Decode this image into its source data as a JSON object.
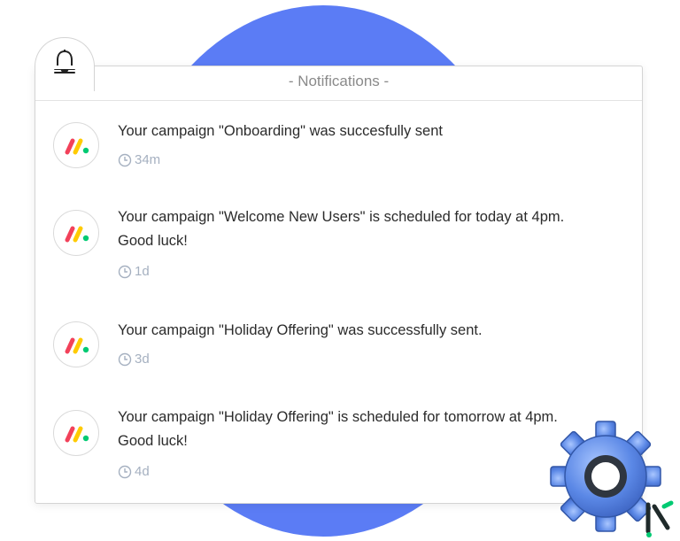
{
  "header": {
    "title": "- Notifications -"
  },
  "icons": {
    "bell": "bell-icon",
    "clock": "clock-icon",
    "gear": "gear-icon",
    "brand": "monday-logo-icon"
  },
  "colors": {
    "blob": "#5b7cf5",
    "logo_red": "#f2415a",
    "logo_yellow": "#ffcb00",
    "logo_green": "#00ca72"
  },
  "notifications": [
    {
      "message": "Your campaign \"Onboarding\" was succesfully sent",
      "time": "34m"
    },
    {
      "message": "Your campaign \"Welcome New Users\" is scheduled for today at 4pm. Good luck!",
      "time": "1d"
    },
    {
      "message": "Your campaign \"Holiday Offering\" was successfully sent.",
      "time": "3d"
    },
    {
      "message": "Your campaign \"Holiday Offering\" is scheduled for tomorrow at 4pm. Good luck!",
      "time": "4d"
    }
  ]
}
